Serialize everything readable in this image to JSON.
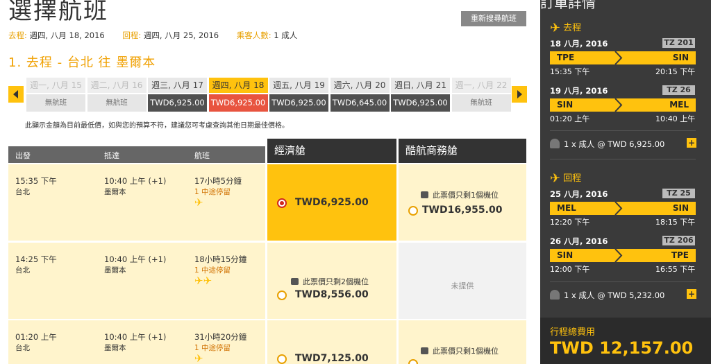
{
  "page_title": "選擇航班",
  "research_button": "重新搜尋航班",
  "summary": {
    "outbound_label": "去程:",
    "outbound_date": "週四, 八月 18, 2016",
    "return_label": "回程:",
    "return_date": "週四, 八月 25, 2016",
    "pax_label": "乘客人數:",
    "pax_value": "1 成人"
  },
  "section_title": "1. 去程 - 台北 往 墨爾本",
  "date_strip": [
    {
      "label": "週一, 八月 15",
      "price": "無航班",
      "state": "none"
    },
    {
      "label": "週二, 八月 16",
      "price": "無航班",
      "state": "none"
    },
    {
      "label": "週三, 八月 17",
      "price": "TWD6,925.00",
      "state": "avail"
    },
    {
      "label": "週四, 八月 18",
      "price": "TWD6,925.00",
      "state": "sel"
    },
    {
      "label": "週五, 八月 19",
      "price": "TWD6,925.00",
      "state": "avail"
    },
    {
      "label": "週六, 八月 20",
      "price": "TWD6,645.00",
      "state": "avail"
    },
    {
      "label": "週日, 八月 21",
      "price": "TWD6,925.00",
      "state": "avail"
    },
    {
      "label": "週一, 八月 22",
      "price": "無航班",
      "state": "none"
    }
  ],
  "date_note": "此顯示金額為目前最低價，如與您的預算不符，建議您可考慮查詢其他日期最佳價格。",
  "table": {
    "col_depart": "出發",
    "col_arrive": "抵達",
    "col_flight": "航班",
    "fare_economy": "經濟艙",
    "fare_business": "酷航商務艙"
  },
  "flights": [
    {
      "dep_time": "15:35 下午",
      "dep_city": "台北",
      "arr_time": "10:40 上午 (+1)",
      "arr_city": "墨爾本",
      "duration": "17小時5分鐘",
      "stops": "1 中途停留",
      "planes": "✈",
      "economy": {
        "price": "TWD6,925.00",
        "seats": "",
        "selected": true
      },
      "business": {
        "price": "TWD16,955.00",
        "seats": "此票價只剩1個機位",
        "available": true
      }
    },
    {
      "dep_time": "14:25 下午",
      "dep_city": "台北",
      "arr_time": "10:40 上午 (+1)",
      "arr_city": "墨爾本",
      "duration": "18小時15分鐘",
      "stops": "1 中途停留",
      "planes": "✈✈",
      "economy": {
        "price": "TWD8,556.00",
        "seats": "此票價只剩2個機位",
        "selected": false
      },
      "business": {
        "price": "",
        "seats": "",
        "available": false,
        "na_text": "未提供"
      }
    },
    {
      "dep_time": "01:20 上午",
      "dep_city": "台北",
      "arr_time": "10:40 上午 (+1)",
      "arr_city": "墨爾本",
      "duration": "31小時20分鐘",
      "stops": "1 中途停留",
      "planes": "✈",
      "economy": {
        "price": "TWD7,125.00",
        "seats": "",
        "selected": false
      },
      "business": {
        "price": "",
        "seats": "此票價只剩1個機位",
        "available": true
      }
    }
  ],
  "sidebar": {
    "title": "訂單詳情",
    "outbound_label": "去程",
    "return_label": "回程",
    "segments": [
      {
        "date": "18 八月, 2016",
        "code": "TZ 201",
        "from": "TPE",
        "to": "SIN",
        "dep": "15:35 下午",
        "arr": "20:15 下午"
      },
      {
        "date": "19 八月, 2016",
        "code": "TZ 26",
        "from": "SIN",
        "to": "MEL",
        "dep": "01:20 上午",
        "arr": "10:40 上午"
      },
      {
        "date": "25 八月, 2016",
        "code": "TZ 25",
        "from": "MEL",
        "to": "SIN",
        "dep": "12:20 下午",
        "arr": "18:15 下午"
      },
      {
        "date": "26 八月, 2016",
        "code": "TZ 206",
        "from": "SIN",
        "to": "TPE",
        "dep": "12:00 下午",
        "arr": "16:55 下午"
      }
    ],
    "outbound_pax": "1 x 成人 @ TWD 6,925.00",
    "return_pax": "1 x 成人 @ TWD 5,232.00",
    "plus": "+",
    "total_label": "行程總費用",
    "total_value": "TWD 12,157.00"
  },
  "colors": {
    "accent": "#ffc20e",
    "selected_date": "#e8543f",
    "sidebar_bg": "#3a3a3a"
  }
}
